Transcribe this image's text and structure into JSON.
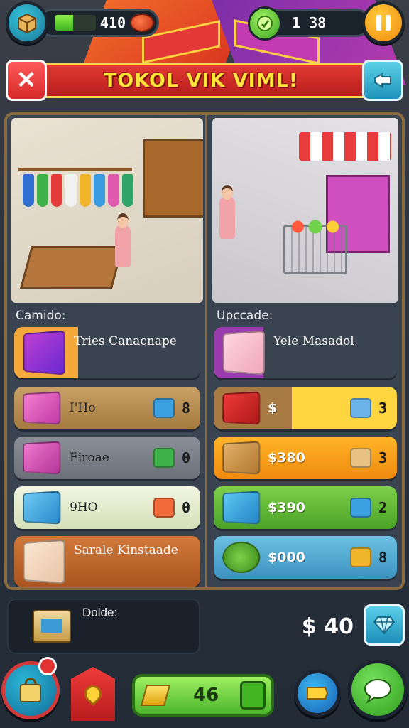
{
  "hud": {
    "energy_value": "410",
    "energy_level": 0.45,
    "gem_value": "1  38",
    "inventory_icon": "crate-icon",
    "food_icon": "ham-icon",
    "gem_icon": "gem-icon",
    "pause_icon": "pause-icon"
  },
  "title": {
    "text": "TOKOL VIK VIML!",
    "close_icon": "close-icon",
    "share_icon": "share-icon"
  },
  "left_column": {
    "label": "Camido:",
    "items": [
      {
        "name": "Tries Canacnape",
        "value": ""
      },
      {
        "name": "I'Ho",
        "value": "8"
      },
      {
        "name": "Firoae",
        "value": "0"
      },
      {
        "name": "9HO",
        "value": "0"
      },
      {
        "name": "Sarale Kinstaade",
        "value": ""
      }
    ]
  },
  "right_column": {
    "label": "Upccade:",
    "items": [
      {
        "name": "Yele Masadol",
        "price": "",
        "value": ""
      },
      {
        "name": "",
        "price": "$",
        "value": "3"
      },
      {
        "name": "",
        "price": "$380",
        "value": "3"
      },
      {
        "name": "",
        "price": "$390",
        "value": "2"
      },
      {
        "name": "",
        "price": "$000",
        "value": "8"
      }
    ]
  },
  "bottom": {
    "inventory_label": "Dolde:",
    "money": "$ 40",
    "level_value": "46"
  },
  "colors": {
    "accent_red": "#e23838",
    "accent_green": "#4cb62c",
    "panel_border": "#8a6a3a"
  }
}
